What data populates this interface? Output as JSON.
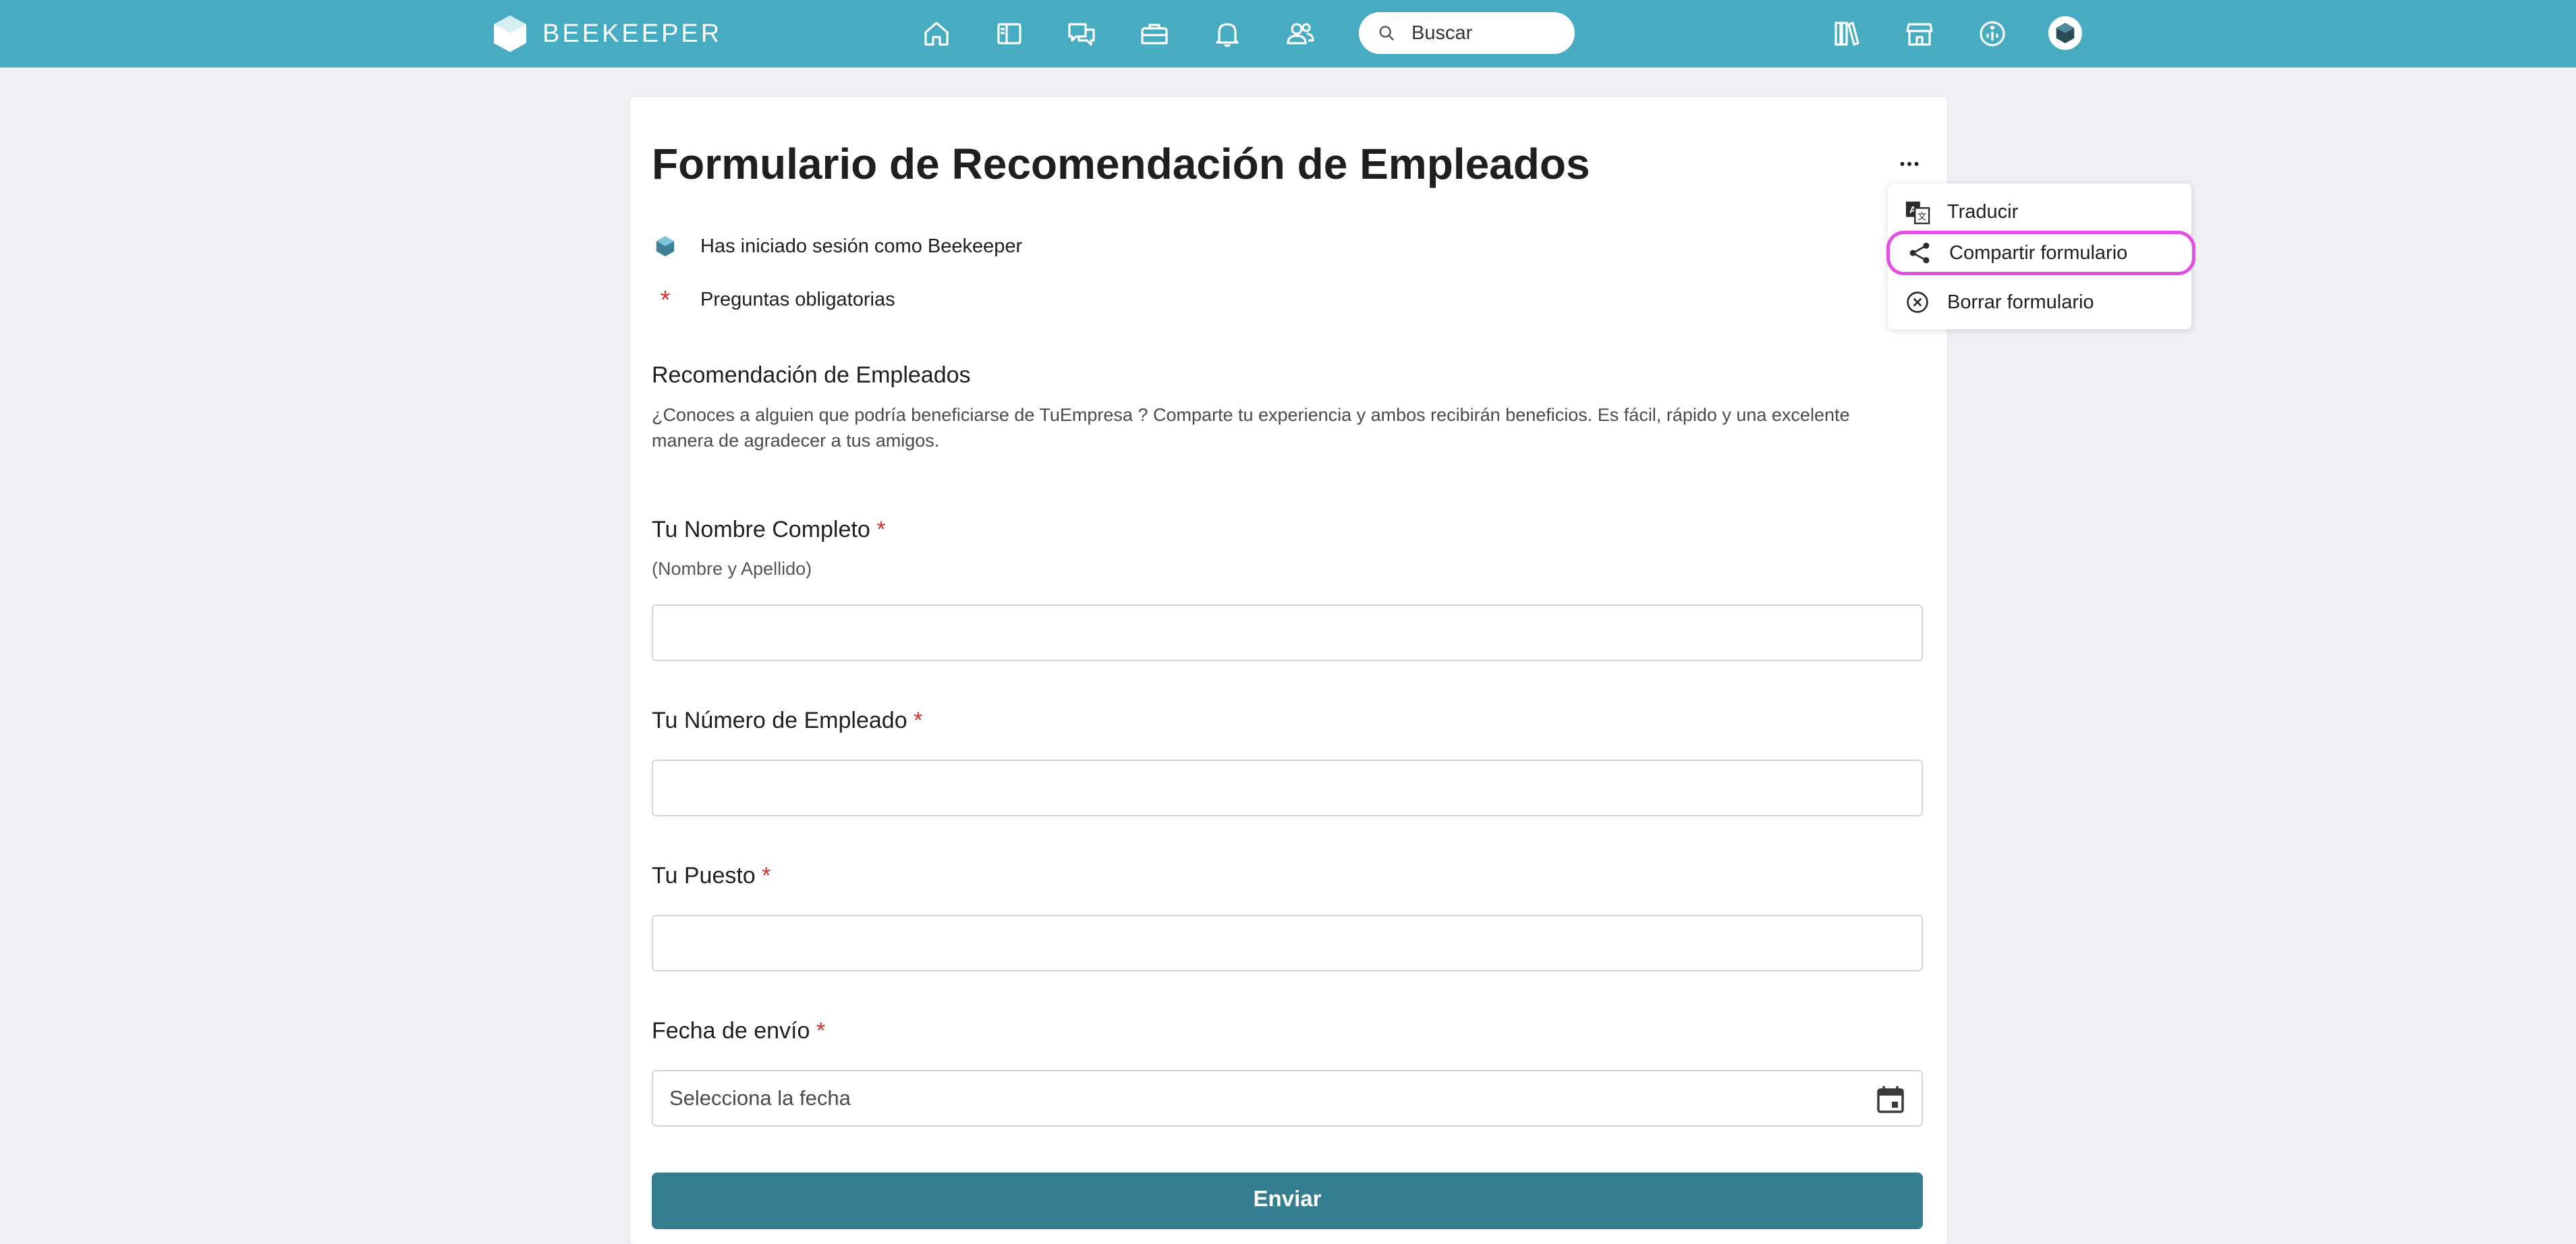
{
  "app": {
    "brand_name": "BEEKEEPER",
    "brand_color": "#47abc2"
  },
  "topbar": {
    "nav_icons": [
      "home-icon",
      "streams-icon",
      "chats-icon",
      "toolbox-icon",
      "notifications-icon",
      "people-icon"
    ],
    "search_placeholder": "Buscar",
    "right_icons": [
      "library-icon",
      "store-icon",
      "info-icon",
      "profile-avatar"
    ]
  },
  "form": {
    "title": "Formulario de Recomendación de Empleados",
    "logged_in_prefix": "Has iniciado sesión como ",
    "logged_in_user": "Beekeeper",
    "required_note": "Preguntas obligatorias",
    "required_marker": "*",
    "section_title": "Recomendación de Empleados",
    "section_description": "¿Conoces a alguien que podría beneficiarse de TuEmpresa ? Comparte tu experiencia y ambos recibirán beneficios. Es fácil, rápido y una excelente manera de agradecer a tus amigos.",
    "questions": [
      {
        "label": "Tu Nombre Completo",
        "hint": "(Nombre y Apellido)",
        "value": ""
      },
      {
        "label": "Tu Número de Empleado",
        "value": ""
      },
      {
        "label": "Tu Puesto",
        "value": ""
      },
      {
        "label": "Fecha de envío",
        "placeholder": "Selecciona la fecha",
        "value": ""
      }
    ],
    "submit_label": "Enviar"
  },
  "context_menu": {
    "items": [
      {
        "label": "Traducir",
        "icon": "translate-icon"
      },
      {
        "label": "Compartir formulario",
        "icon": "share-icon",
        "highlighted": true
      },
      {
        "label": "Borrar formulario",
        "icon": "delete-circle-icon"
      }
    ],
    "highlight_color": "#e34ee3"
  },
  "colors": {
    "required": "#d0312d",
    "submit_button": "#347e90",
    "page_background": "#efeff4"
  }
}
